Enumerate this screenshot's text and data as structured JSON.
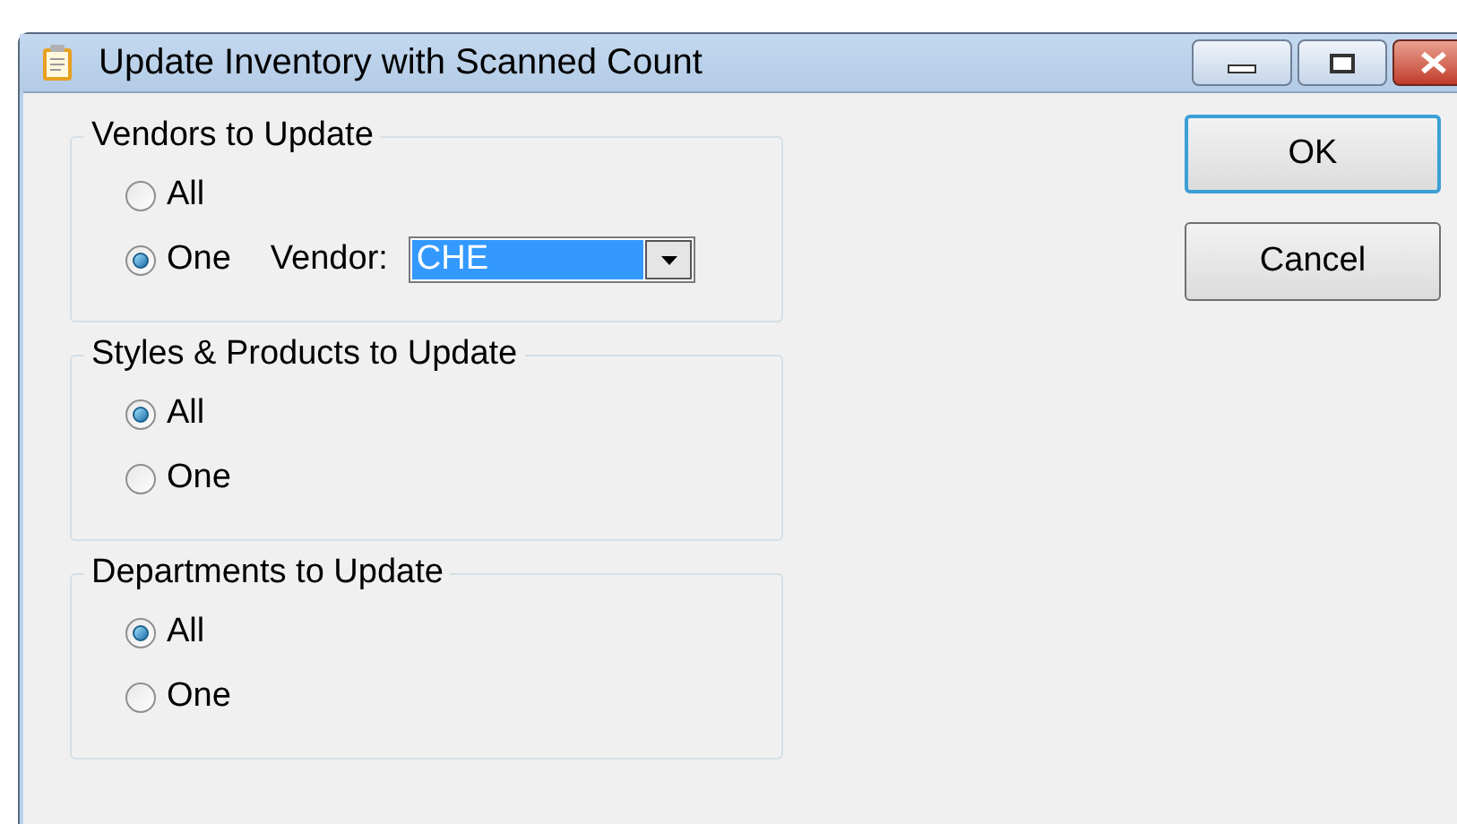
{
  "window": {
    "title": "Update Inventory with Scanned Count"
  },
  "groups": [
    {
      "title": "Vendors to Update",
      "options": [
        {
          "label": "All",
          "selected": false
        },
        {
          "label": "One",
          "selected": true
        }
      ],
      "field": {
        "label": "Vendor:",
        "value": "CHE"
      }
    },
    {
      "title": "Styles & Products to Update",
      "options": [
        {
          "label": "All",
          "selected": true
        },
        {
          "label": "One",
          "selected": false
        }
      ]
    },
    {
      "title": "Departments to Update",
      "options": [
        {
          "label": "All",
          "selected": true
        },
        {
          "label": "One",
          "selected": false
        }
      ]
    }
  ],
  "buttons": [
    {
      "label": "OK",
      "default": true
    },
    {
      "label": "Cancel",
      "default": false
    }
  ]
}
